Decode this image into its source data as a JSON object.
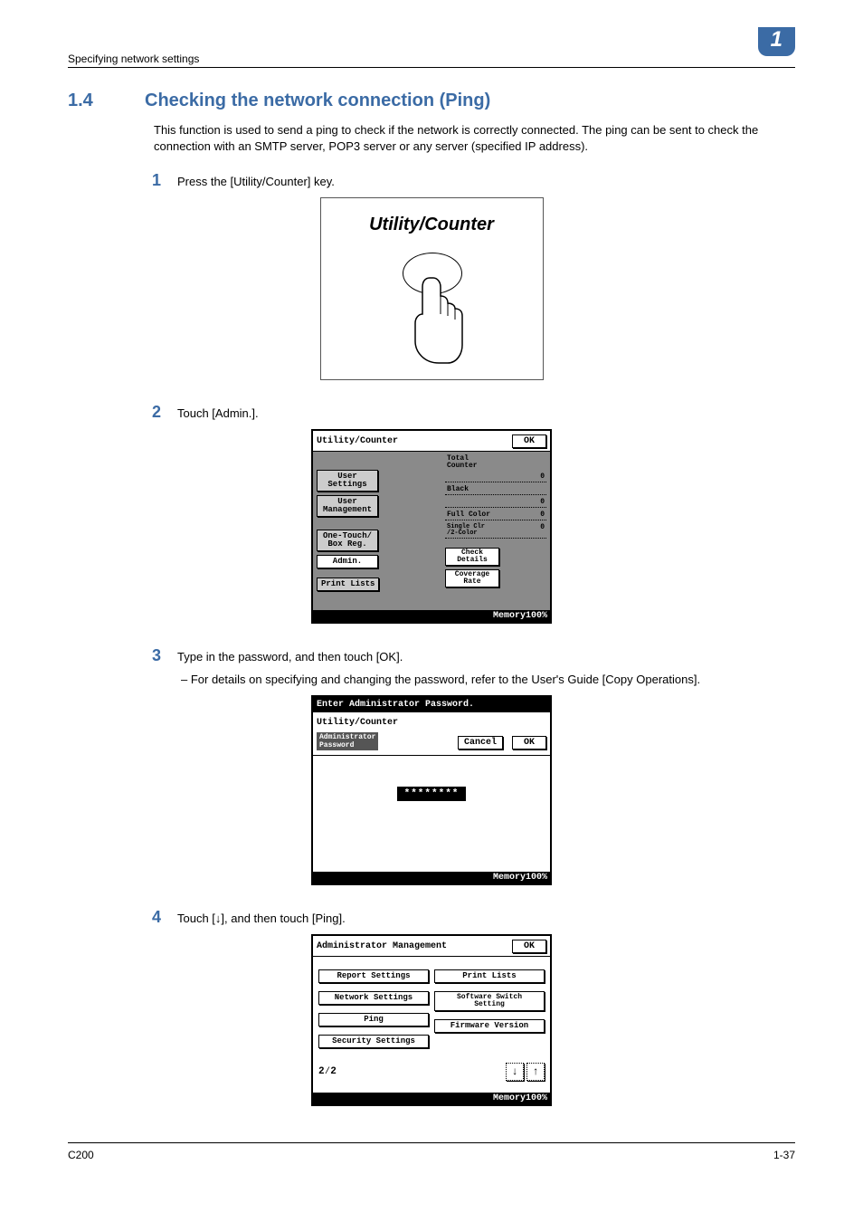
{
  "header": {
    "section_path": "Specifying network settings",
    "chapter_badge": "1"
  },
  "section": {
    "number": "1.4",
    "title": "Checking the network connection (Ping)",
    "intro": "This function is used to send a ping to check if the network is correctly connected. The ping can be sent to check the connection with an SMTP server, POP3 server or any server (specified IP address)."
  },
  "steps": [
    {
      "n": "1",
      "text": "Press the [Utility/Counter] key."
    },
    {
      "n": "2",
      "text": "Touch [Admin.]."
    },
    {
      "n": "3",
      "text": "Type in the password, and then touch [OK]."
    },
    {
      "n": "4",
      "text": "Touch [↓], and then touch [Ping]."
    }
  ],
  "sub_bullet_3": "–   For details on specifying and changing the password, refer to the User's Guide [Copy Operations].",
  "fig1_label": "Utility/Counter",
  "lcd2": {
    "title": "Utility/Counter",
    "ok": "OK",
    "buttons_left": [
      "User\nSettings",
      "User\nManagement",
      "One-Touch/\nBox Reg.",
      "Admin.",
      "Print Lists"
    ],
    "counters": {
      "group": "Total\nCounter",
      "lines": [
        {
          "label": "Black",
          "val": "0"
        },
        {
          "label": "Full Color",
          "val": "0"
        },
        {
          "label": "Single Clr\n/2-Color",
          "val": "0"
        }
      ],
      "blank_val": "0"
    },
    "right_buttons": [
      "Check\nDetails",
      "Coverage\nRate"
    ],
    "memory": "Memory100%"
  },
  "lcd3": {
    "prompt": "Enter Administrator Password.",
    "breadcrumb": "Utility/Counter",
    "field_label": "Administrator\nPassword",
    "cancel": "Cancel",
    "ok": "OK",
    "masked": "********",
    "memory": "Memory100%"
  },
  "lcd4": {
    "title": "Administrator Management",
    "ok": "OK",
    "left": [
      "Report Settings",
      "Network Settings",
      "Ping",
      "Security Settings"
    ],
    "right": [
      "Print Lists",
      "Software Switch\nSetting",
      "Firmware Version"
    ],
    "page": "2⁄2",
    "memory": "Memory100%"
  },
  "footer": {
    "model": "C200",
    "page": "1-37"
  }
}
